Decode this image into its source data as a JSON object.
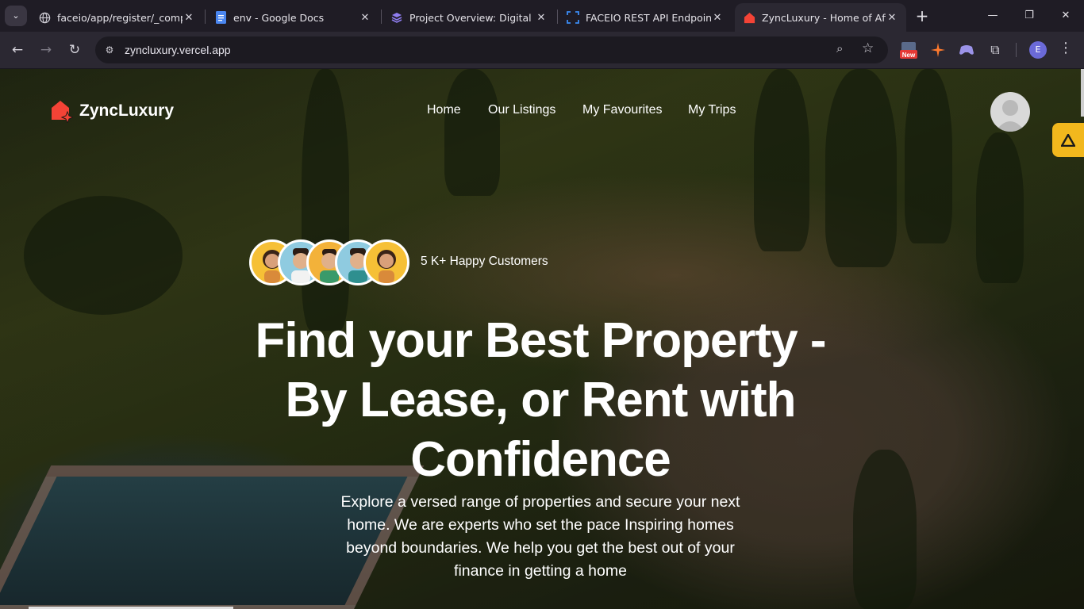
{
  "browser": {
    "tabs": [
      {
        "title": "faceio/app/register/_compor",
        "favicon": "globe-icon",
        "active": false
      },
      {
        "title": "env - Google Docs",
        "favicon": "google-docs-icon",
        "active": false
      },
      {
        "title": "Project Overview: Digital Wa",
        "favicon": "project-icon",
        "active": false
      },
      {
        "title": "FACEIO REST API Endpoints",
        "favicon": "faceio-icon",
        "active": false
      },
      {
        "title": "ZyncLuxury - Home of Afford",
        "favicon": "zyncluxury-icon",
        "active": true
      }
    ],
    "url": "zyncluxury.vercel.app",
    "extensions": [
      "new-badge-extension-icon",
      "spark-extension-icon",
      "game-extension-icon",
      "puzzle-icon"
    ],
    "extension_badge": "New",
    "profile_initial": "E",
    "accent": "#6b6ad8"
  },
  "site": {
    "brand": "ZyncLuxury",
    "brand_color": "#f44336",
    "nav": [
      "Home",
      "Our Listings",
      "My Favourites",
      "My Trips"
    ],
    "hero": {
      "customers": "5 K+ Happy Customers",
      "headline_lines": [
        "Find your Best Property -",
        "By Lease, or Rent with",
        "Confidence"
      ],
      "subcopy": "Explore a versed range of properties and secure your next home. We are experts who set the pace Inspiring homes beyond boundaries. We help you get the best out of your finance in getting a home"
    },
    "side_badge_color": "#f2b81d"
  }
}
